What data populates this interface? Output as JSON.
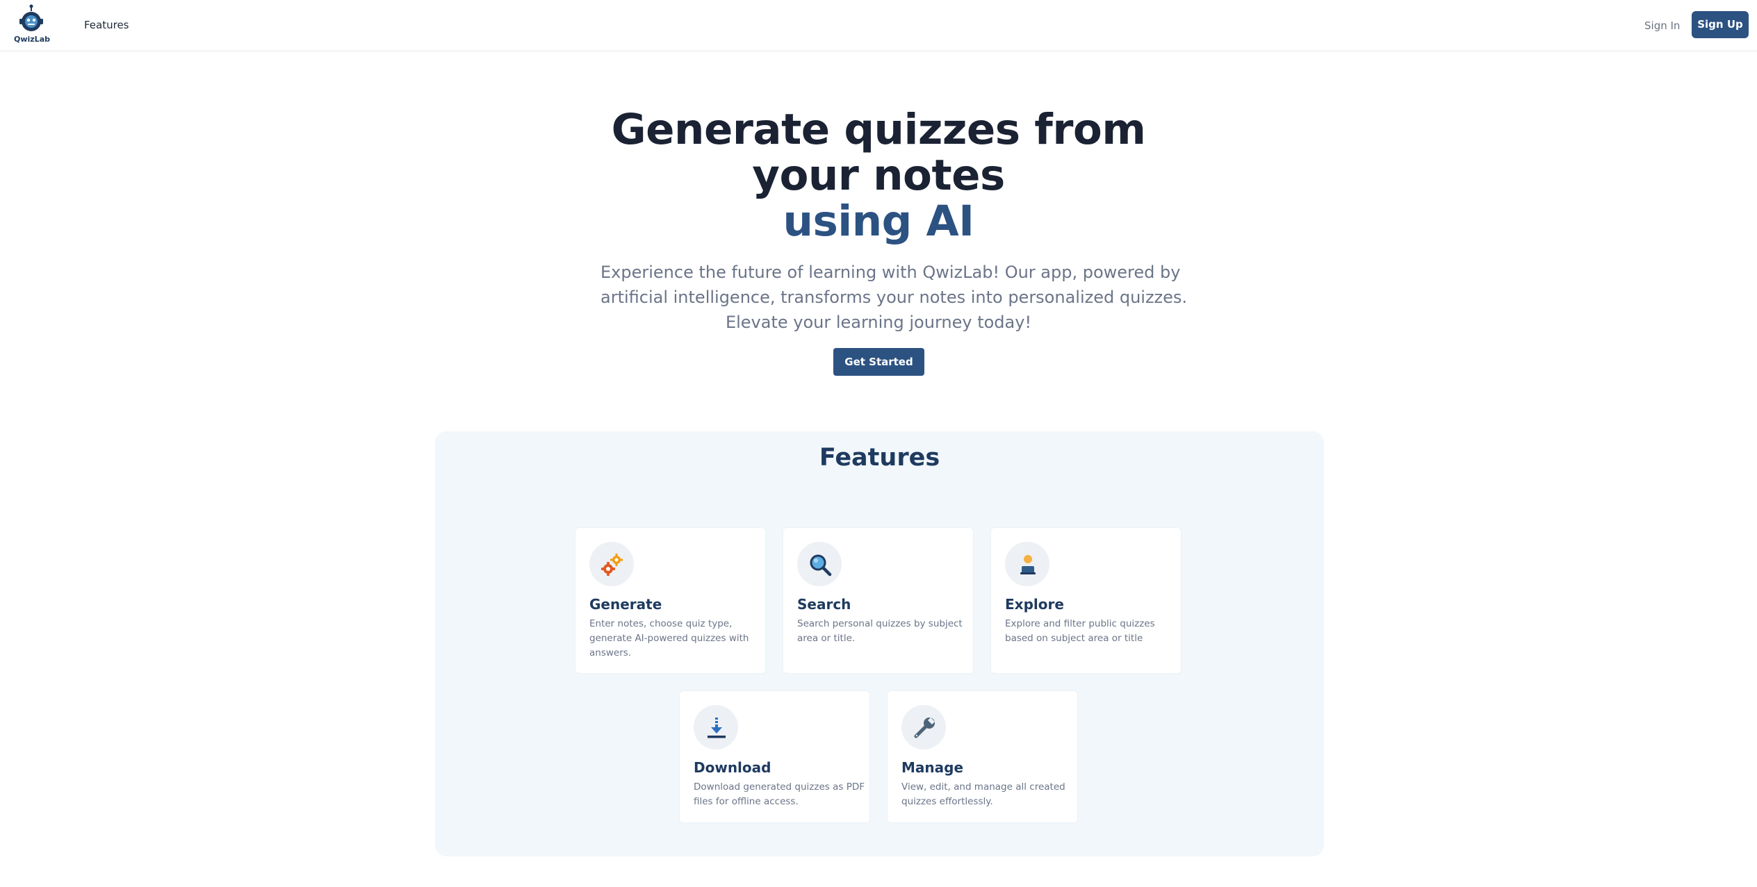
{
  "nav": {
    "brand": "QwizLab",
    "links": [
      "Features"
    ],
    "signin": "Sign In",
    "signup": "Sign Up"
  },
  "hero": {
    "title_lines": [
      "Generate quizzes from",
      "your notes"
    ],
    "title_accent": "using AI",
    "subtitle_lines": [
      "Experience the future of learning with QwizLab! Our app, powered by",
      "artificial intelligence, transforms your notes into personalized quizzes.",
      "Elevate your learning journey today!"
    ],
    "cta": "Get Started"
  },
  "features": {
    "title": "Features",
    "cards": [
      {
        "title": "Generate",
        "icon": "gears-icon",
        "desc_lines": [
          "Enter notes, choose quiz type,",
          "generate AI-powered quizzes with",
          "answers."
        ]
      },
      {
        "title": "Search",
        "icon": "magnifier-icon",
        "desc_lines": [
          "Search personal quizzes by subject",
          "area or title."
        ]
      },
      {
        "title": "Explore",
        "icon": "person-icon",
        "desc_lines": [
          "Explore and filter public quizzes",
          "based on subject area or title"
        ]
      },
      {
        "title": "Download",
        "icon": "download-icon",
        "desc_lines": [
          "Download generated quizzes as PDF",
          "files for offline access."
        ]
      },
      {
        "title": "Manage",
        "icon": "wrench-icon",
        "desc_lines": [
          "View, edit, and manage all created",
          "quizzes effortlessly."
        ]
      }
    ]
  },
  "colors": {
    "primary": "#2c5282",
    "heading": "#1a2233",
    "muted": "#6b7488",
    "features_bg": "#f1f7fb"
  }
}
